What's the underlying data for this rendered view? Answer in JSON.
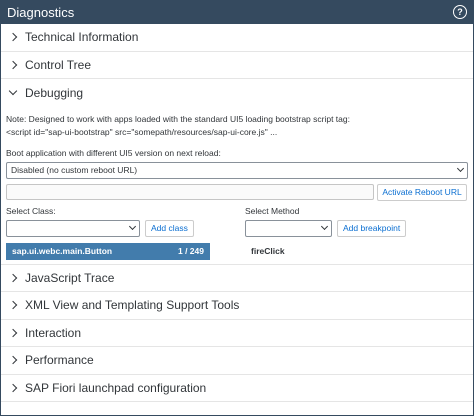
{
  "window": {
    "title": "Diagnostics"
  },
  "sections_top": [
    {
      "label": "Technical Information",
      "expanded": false
    },
    {
      "label": "Control Tree",
      "expanded": false
    },
    {
      "label": "Debugging",
      "expanded": true
    }
  ],
  "debugging": {
    "note_line1": "Note: Designed to work with apps loaded with the standard UI5 loading bootstrap script tag:",
    "note_line2": "<script id=\"sap-ui-bootstrap\" src=\"somepath/resources/sap-ui-core.js\" ...",
    "boot_label": "Boot application with different UI5 version on next reload:",
    "boot_select_value": "Disabled (no custom reboot URL)",
    "reboot_url_value": "",
    "activate_button": "Activate Reboot URL",
    "select_class_label": "Select Class:",
    "select_class_value": "",
    "add_class_button": "Add class",
    "select_method_label": "Select Method",
    "select_method_value": "",
    "add_breakpoint_button": "Add breakpoint",
    "class_entry": {
      "name": "sap.ui.webc.main.Button",
      "count": "1 / 249"
    },
    "method_entry": "fireClick"
  },
  "sections_bottom": [
    {
      "label": "JavaScript Trace",
      "expanded": false
    },
    {
      "label": "XML View and Templating Support Tools",
      "expanded": false
    },
    {
      "label": "Interaction",
      "expanded": false
    },
    {
      "label": "Performance",
      "expanded": false
    },
    {
      "label": "SAP Fiori launchpad configuration",
      "expanded": false
    }
  ],
  "colors": {
    "header": "#354a5f",
    "selected": "#427cac",
    "link": "#0a6ed1"
  }
}
